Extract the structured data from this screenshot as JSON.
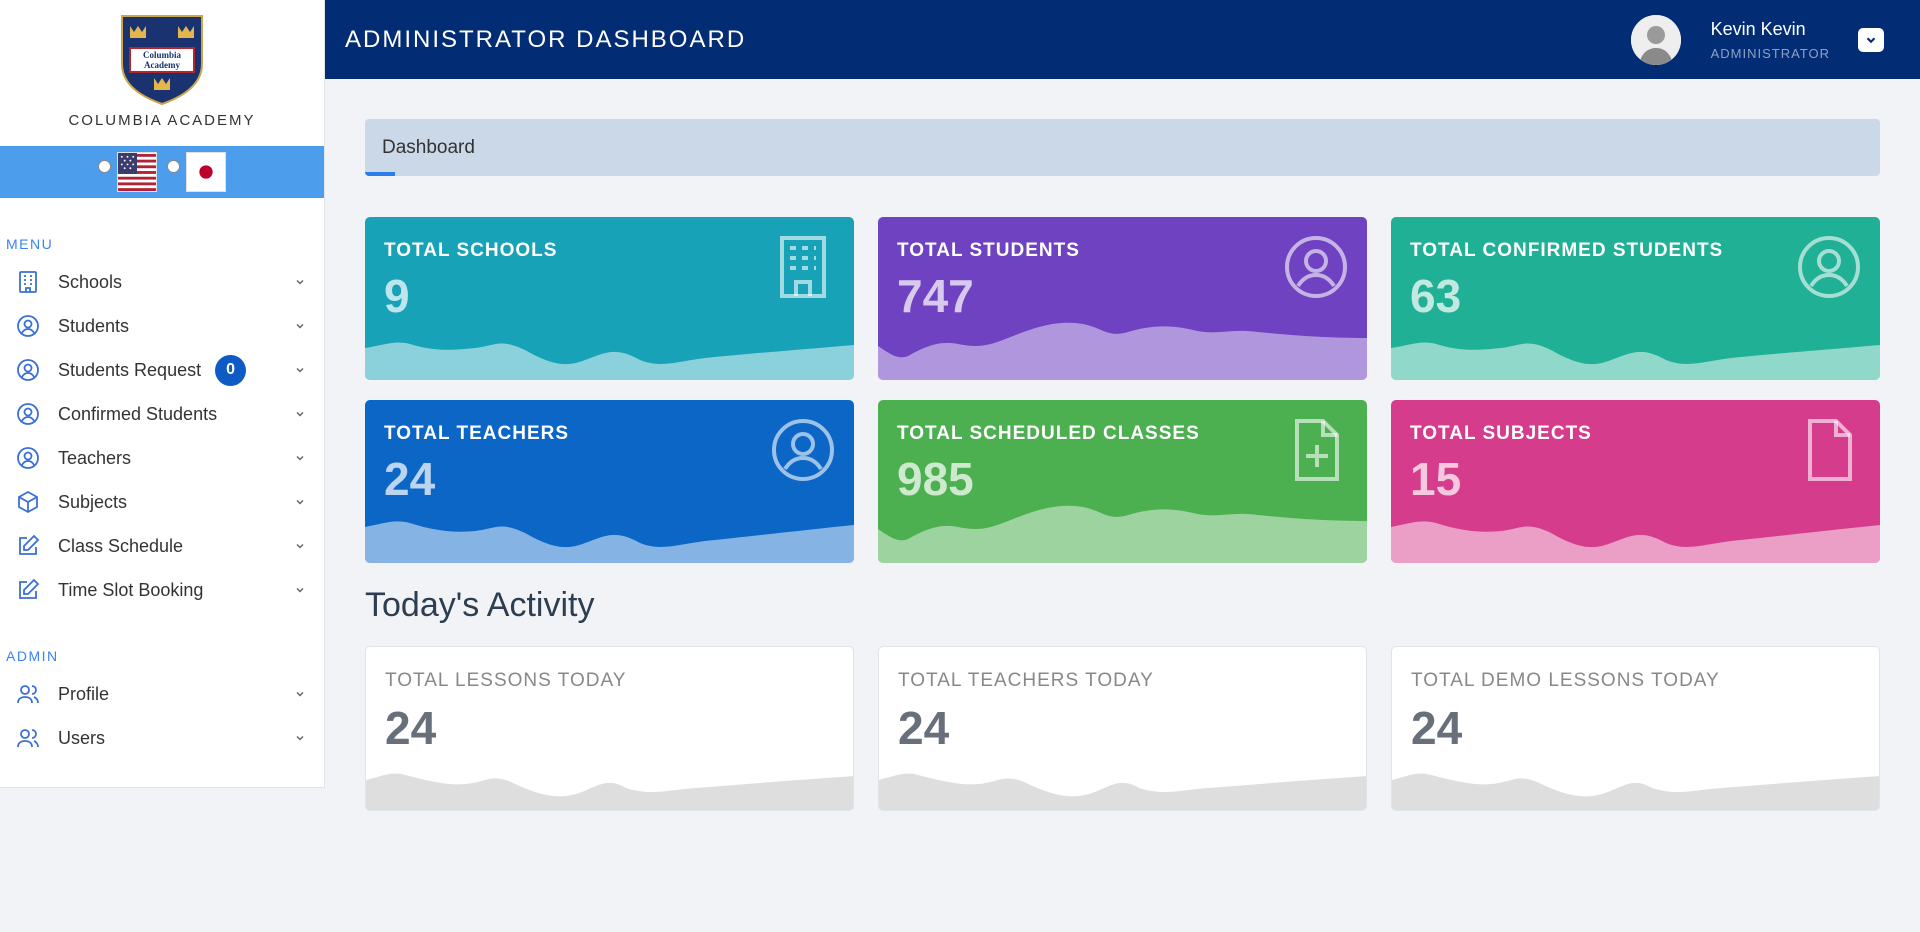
{
  "brand": {
    "crest_text_1": "Columbia",
    "crest_text_2": "Academy",
    "name": "COLUMBIA ACADEMY"
  },
  "languages": [
    {
      "code": "en",
      "flag": "us-flag-icon",
      "selected": false
    },
    {
      "code": "ja",
      "flag": "japan-flag-icon",
      "selected": false
    }
  ],
  "sidebar": {
    "menu_label": "MENU",
    "menu_items": [
      {
        "label": "Schools",
        "icon": "building-icon"
      },
      {
        "label": "Students",
        "icon": "user-circle-icon"
      },
      {
        "label": "Students Request",
        "icon": "user-circle-icon",
        "badge": "0"
      },
      {
        "label": "Confirmed Students",
        "icon": "user-circle-icon"
      },
      {
        "label": "Teachers",
        "icon": "user-circle-icon"
      },
      {
        "label": "Subjects",
        "icon": "cube-icon"
      },
      {
        "label": "Class Schedule",
        "icon": "edit-icon"
      },
      {
        "label": "Time Slot Booking",
        "icon": "edit-icon"
      }
    ],
    "admin_label": "ADMIN",
    "admin_items": [
      {
        "label": "Profile",
        "icon": "users-icon"
      },
      {
        "label": "Users",
        "icon": "users-icon"
      }
    ]
  },
  "header": {
    "title": "ADMINISTRATOR DASHBOARD",
    "user_name": "Kevin Kevin",
    "user_role": "ADMINISTRATOR"
  },
  "breadcrumb": "Dashboard",
  "stats": [
    {
      "title": "TOTAL SCHOOLS",
      "value": "9",
      "color": "#17a2b8",
      "icon": "building-icon"
    },
    {
      "title": "TOTAL STUDENTS",
      "value": "747",
      "color": "#6f42c1",
      "icon": "user-circle-icon"
    },
    {
      "title": "TOTAL CONFIRMED STUDENTS",
      "value": "63",
      "color": "#20b095",
      "icon": "user-circle-icon"
    },
    {
      "title": "TOTAL TEACHERS",
      "value": "24",
      "color": "#0b66c6",
      "icon": "user-circle-icon"
    },
    {
      "title": "TOTAL SCHEDULED CLASSES",
      "value": "985",
      "color": "#4caf50",
      "icon": "file-plus-icon"
    },
    {
      "title": "TOTAL SUBJECTS",
      "value": "15",
      "color": "#d63c8c",
      "icon": "file-icon"
    }
  ],
  "activity": {
    "title": "Today's Activity",
    "cards": [
      {
        "title": "TOTAL LESSONS TODAY",
        "value": "24"
      },
      {
        "title": "TOTAL TEACHERS TODAY",
        "value": "24"
      },
      {
        "title": "TOTAL DEMO LESSONS TODAY",
        "value": "24"
      }
    ]
  }
}
